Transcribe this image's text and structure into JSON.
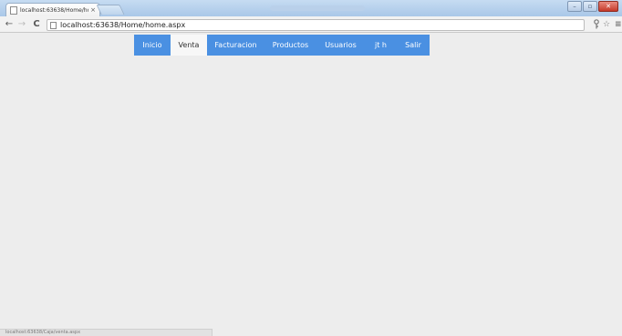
{
  "browser": {
    "tab": {
      "title": "localhost:63638/Home/ho",
      "close": "×"
    },
    "url": "localhost:63638/Home/home.aspx",
    "window_controls": {
      "minimize": "–",
      "maximize": "▫",
      "close": "✕"
    },
    "icons": {
      "back": "arrow-left-icon",
      "forward": "arrow-right-icon",
      "reload": "reload-icon",
      "key": "key-icon",
      "star": "star-icon",
      "menu": "hamburger-menu-icon"
    }
  },
  "nav_menu": {
    "items": [
      {
        "label": "Inicio"
      },
      {
        "label": "Venta"
      },
      {
        "label": "Facturacion"
      },
      {
        "label": "Productos"
      },
      {
        "label": "Usuarios"
      },
      {
        "label": "jt h"
      },
      {
        "label": "Salir"
      }
    ],
    "active_index": 1,
    "accent_color": "#4a90e2"
  },
  "status": {
    "link_preview": "localhost:63638/Caja/venta.aspx"
  }
}
